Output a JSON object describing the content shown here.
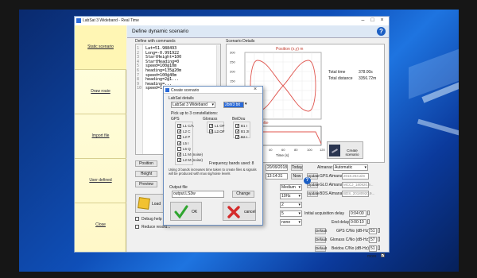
{
  "window": {
    "title": "LabSat 3 Wideband - Real Time"
  },
  "sidebar": {
    "items": [
      {
        "label": "Static scenario"
      },
      {
        "label": "Draw route"
      },
      {
        "label": "Import file"
      },
      {
        "label": "User defined"
      },
      {
        "label": "Close"
      }
    ]
  },
  "header": {
    "title": "Define dynamic scenario"
  },
  "commands": {
    "title": "Define with commands",
    "lines": [
      "Lat=51.988493",
      "Long=-0.991922",
      "StartHeight=100",
      "StartHeading=0",
      "speed=100@10m",
      "heading=135@20m",
      "speed=100@40m",
      "heading=2@1...",
      "heading=...",
      "speed=1..."
    ],
    "line_numbers": [
      "1",
      "2",
      "3",
      "4",
      "5",
      "6",
      "7",
      "8",
      "9",
      "10"
    ]
  },
  "buttons": {
    "position": "Position",
    "height": "Height",
    "preview": "Preview",
    "load": "Load",
    "create_scenario": "Create scenario"
  },
  "options": {
    "debug_help": "Debug help - sh...",
    "reduce_resolution": "Reduce resolu..."
  },
  "details": {
    "title": "Scenario Details",
    "position_title": "Position (x,y) m",
    "speed_title": "Speed profile",
    "time_label": "Time (s)",
    "total_time_label": "Total time",
    "total_time_value": "378.00s",
    "total_distance_label": "Total distance",
    "total_distance_value": "3356.72m",
    "y_ticks": [
      "300",
      "250",
      "200",
      "150",
      "100",
      "50",
      "0",
      "-50"
    ],
    "x_ticks": [
      "-40",
      "-20",
      "0",
      "20",
      "40",
      "60",
      "80",
      "100",
      "120"
    ],
    "speed_ticks": [
      "0",
      "20",
      "40",
      "60",
      "80",
      "100",
      "120"
    ]
  },
  "settings": {
    "date": "20/09/2018",
    "time": "13:14:31",
    "today": "Today",
    "now": "Now",
    "almanac_label": "Almanac",
    "almanac_value": "Automatic",
    "update": "Update",
    "gps_almanac": "GPS Almanac",
    "gps_almanac_value": "2018.263.alm",
    "glo_almanac": "GLO Almanac",
    "glo_almanac_value": "MCCJ_180920.9...",
    "bds_almanac": "BDS Almanac",
    "bds_almanac_value": "BDS_20180920.9...",
    "level": "Medium",
    "rate": "10Hz",
    "q1": "2",
    "q2": "5",
    "none": "none",
    "initial_delay_label": "Initial acquisition delay",
    "initial_delay_value": "0:04:00",
    "end_delay_label": "End delay",
    "end_delay_value": "0:00:10",
    "default": "Default",
    "gps_cn_label": "GPS C/No (dB-Hz)",
    "gps_cn_value": "51",
    "glo_cn_label": "Glonass C/No (dB-Hz)",
    "glo_cn_value": "57",
    "bds_cn_label": "Beidou C/No (dB-Hz)",
    "bds_cn_value": "51",
    "more_label": "more"
  },
  "dialog": {
    "title": "Create scenario",
    "details_label": "LabSat details",
    "device": "LabSat 3 Wideband",
    "channels": "2bit/3 bit",
    "pick_label": "Pick up to 3 constellations:",
    "gps_head": "GPS",
    "glonass_head": "Glonass",
    "beidou_head": "BeiDou",
    "gps_items": [
      "L1 C/A",
      "L2 C",
      "L2 P",
      "L5 I",
      "L5 Q",
      "L1 M (noise)",
      "L2 M (noise)"
    ],
    "glonass_items": [
      "L1 OF",
      "L2 OF"
    ],
    "beidou_items": [
      "B1 I",
      "B1 2I",
      "B2 I"
    ],
    "bands_used": "Frequency bands used: 8",
    "note": "Using 3 bands increases time taken to create files & signals will be produced with max sig/noise levels",
    "output_label": "Output file",
    "output_value": "output.LS3w",
    "change": "Change",
    "ok": "OK",
    "cancel": "cancel"
  },
  "colors": {
    "curve": "#e0554e",
    "accent": "#1c5fc4"
  }
}
